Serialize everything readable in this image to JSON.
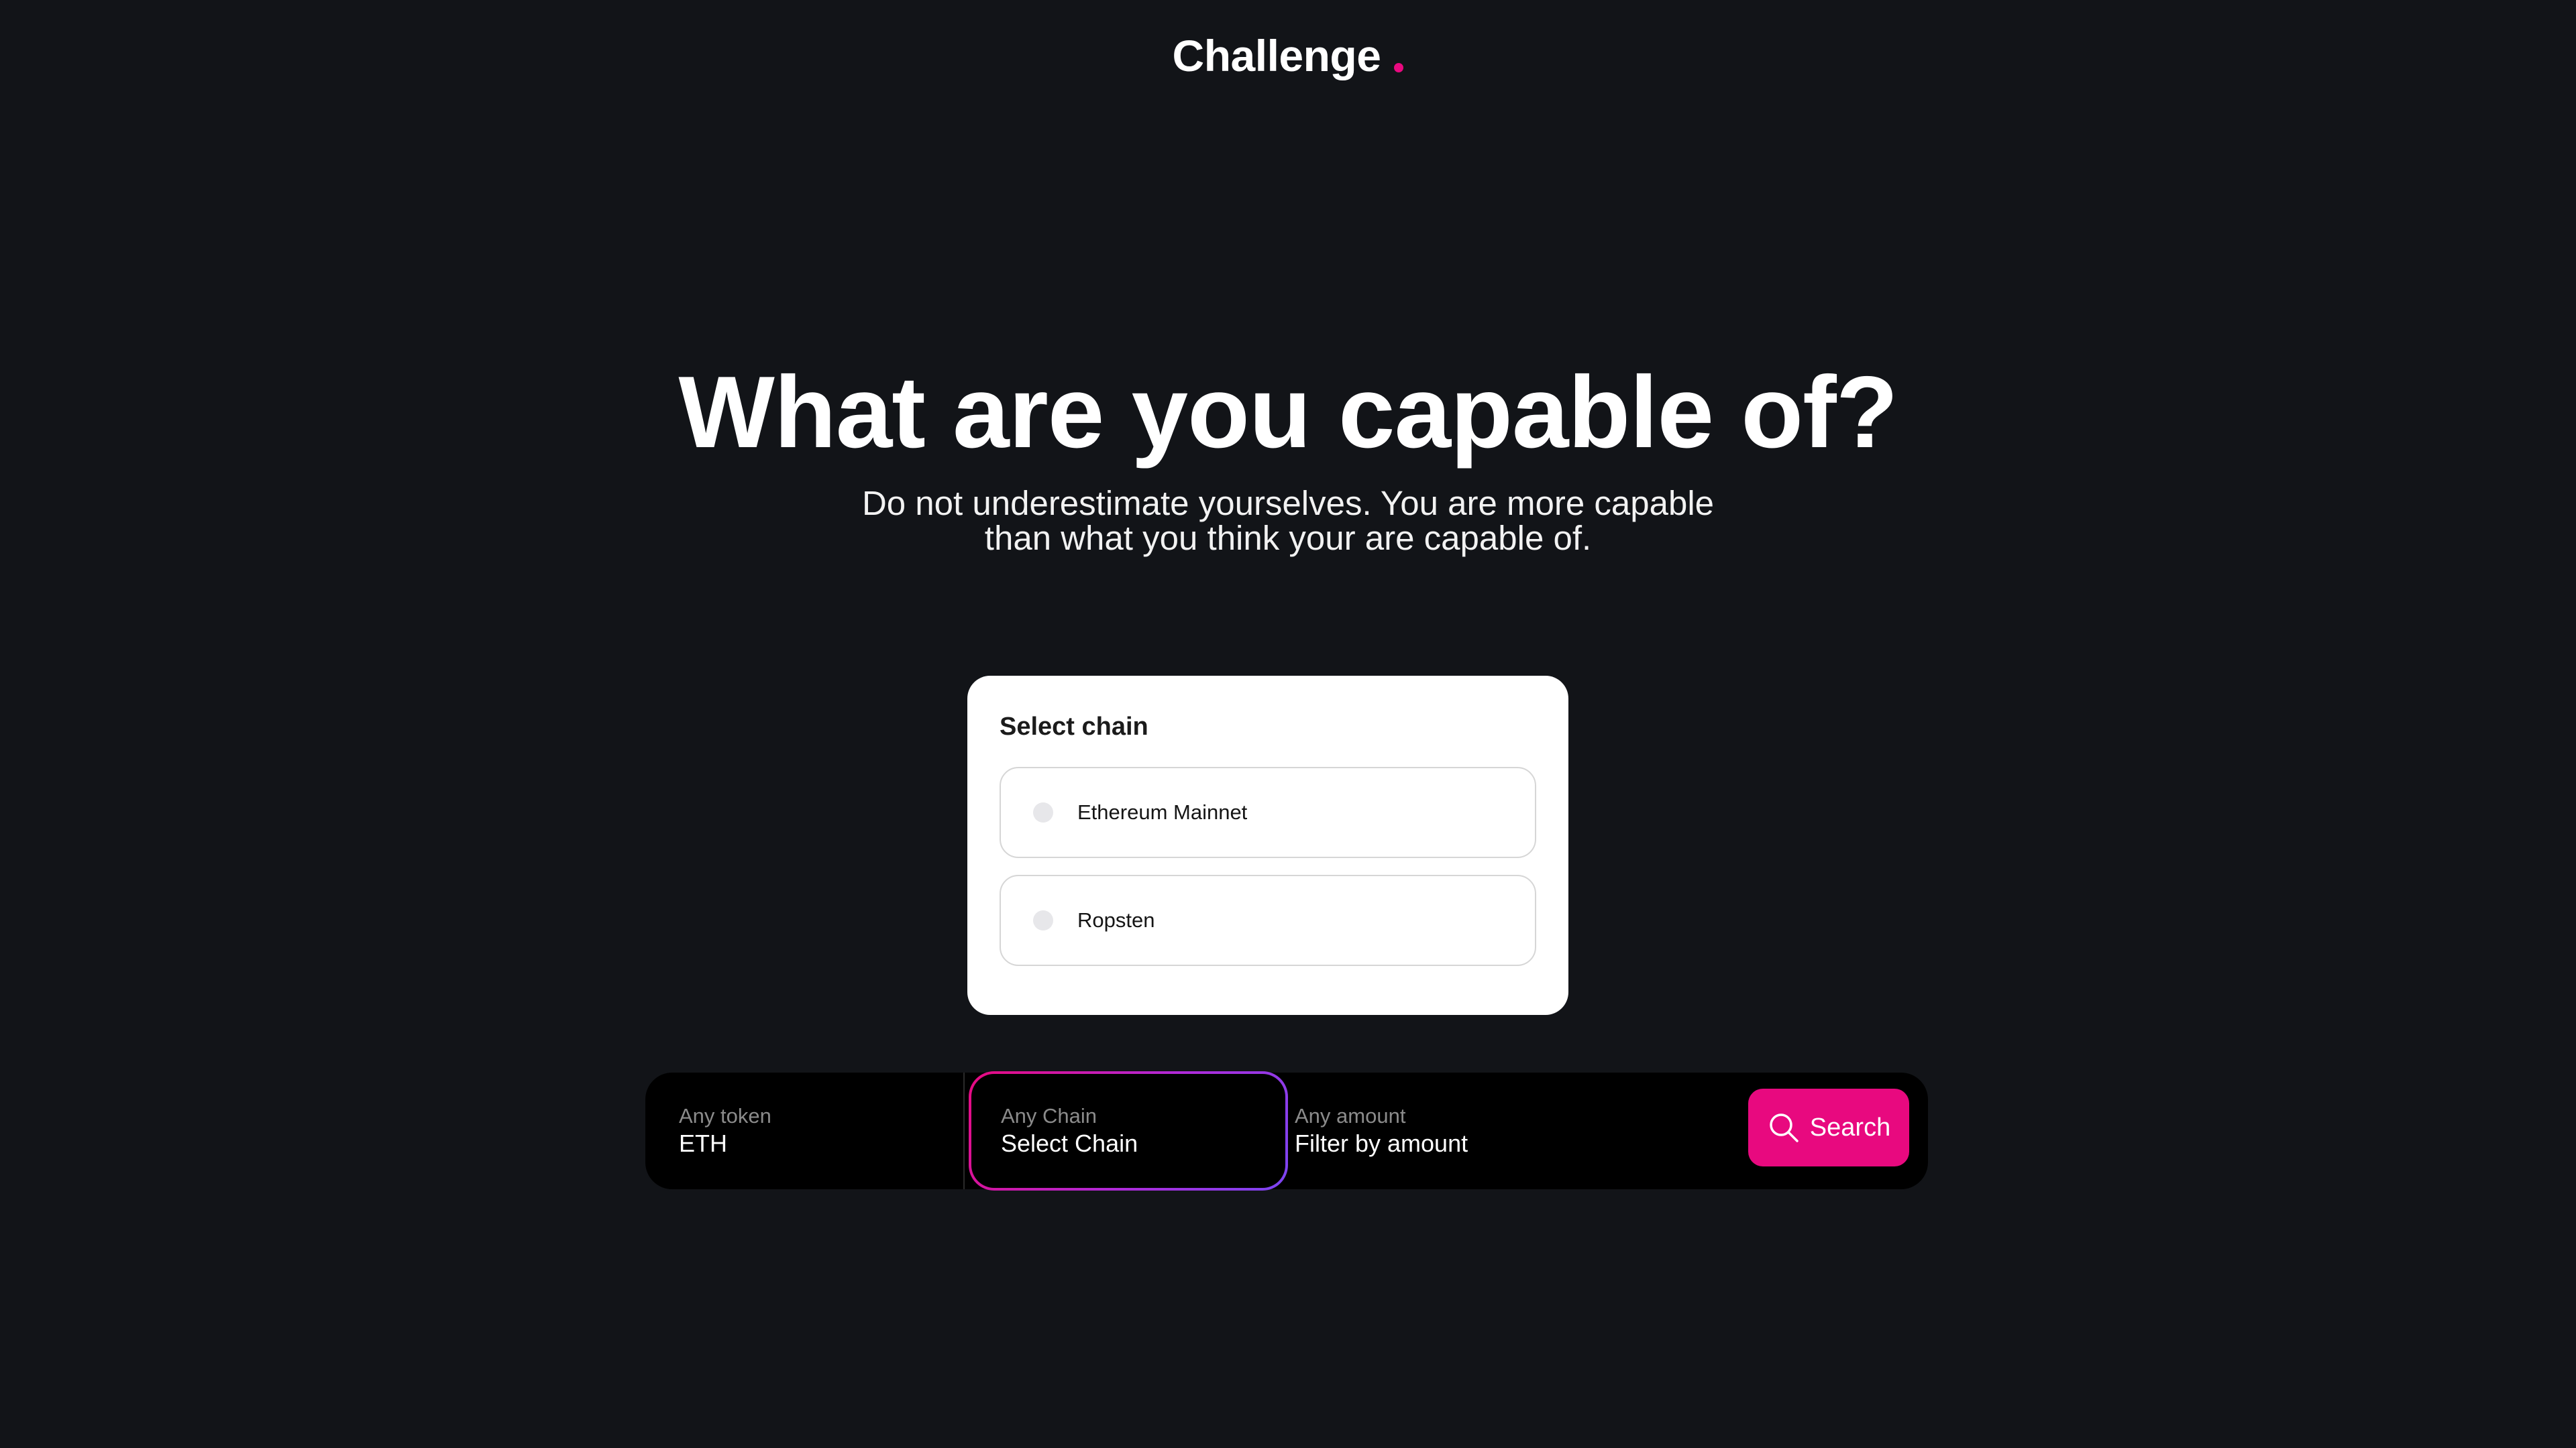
{
  "brand": {
    "name": "Challenge",
    "accent_color": "#e8097f"
  },
  "hero": {
    "title": "What are you capable of?",
    "subtitle_line1": "Do not underestimate yourselves. You are more capable",
    "subtitle_line2": "than what you think your are capable of."
  },
  "chain_selector": {
    "title": "Select chain",
    "options": [
      {
        "label": "Ethereum Mainnet",
        "selected": false
      },
      {
        "label": "Ropsten",
        "selected": false
      }
    ]
  },
  "search_bar": {
    "token": {
      "label": "Any token",
      "value": "ETH"
    },
    "chain": {
      "label": "Any Chain",
      "value": "Select Chain",
      "active": true
    },
    "amount": {
      "label": "Any amount",
      "placeholder": "Filter by amount"
    },
    "search_button": {
      "label": "Search",
      "icon": "search-icon"
    }
  },
  "colors": {
    "background": "#121418",
    "search_bar": "#000000",
    "card": "#ffffff",
    "gradient_start": "#e8097f",
    "gradient_end": "#7b45f2"
  }
}
